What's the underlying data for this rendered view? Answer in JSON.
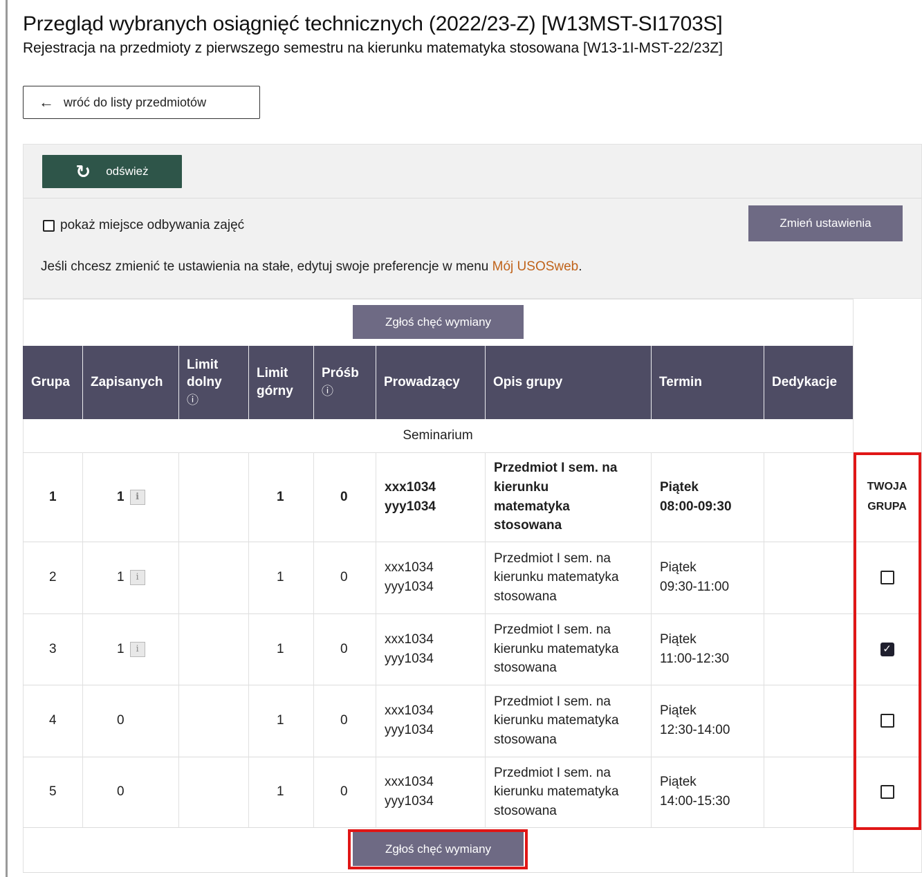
{
  "header": {
    "title": "Przegląd wybranych osiągnięć technicznych (2022/23-Z) [W13MST-SI1703S]",
    "subtitle": "Rejestracja na przedmioty z pierwszego semestru na kierunku matematyka stosowana [W13-1I-MST-22/23Z]"
  },
  "nav": {
    "back_label": "wróć do listy przedmiotów",
    "back_icon": "arrow-left-icon"
  },
  "settings": {
    "refresh_label": "odśwież",
    "show_location_label": "pokaż miejsce odbywania zajęć",
    "show_location_checked": false,
    "change_settings_label": "Zmień ustawienia",
    "pref_text": "Jeśli chcesz zmienić te ustawienia na stałe, edytuj swoje preferencje w menu ",
    "pref_link": "Mój USOSweb",
    "pref_end": ".",
    "link_color": "#c0631a"
  },
  "exchange_button_label": "Zgłoś chęć wymiany",
  "table": {
    "columns": {
      "grupa": "Grupa",
      "zapisanych": "Zapisanych",
      "limit_dolny_1": "Limit",
      "limit_dolny_2": "dolny",
      "limit_gorny_1": "Limit",
      "limit_gorny_2": "górny",
      "prosb": "Próśb",
      "prowadzacy": "Prowadzący",
      "opis": "Opis grupy",
      "termin": "Termin",
      "dedykacje": "Dedykacje",
      "info_icon": "ⓘ"
    },
    "section": "Seminarium",
    "your_group_line1": "TWOJA",
    "your_group_line2": "GRUPA",
    "rows": [
      {
        "grupa": "1",
        "zapisanych": "1",
        "limit_dolny": "",
        "limit_gorny": "1",
        "prosb": "0",
        "prowadzacy_1": "xxx1034",
        "prowadzacy_2": "yyy1034",
        "opis_1": "Przedmiot I sem. na",
        "opis_2": "kierunku",
        "opis_3": "matematyka",
        "opis_4": "stosowana",
        "dzien": "Piątek",
        "godziny": "08:00-09:30",
        "dedykacje": "",
        "selected": true
      },
      {
        "grupa": "2",
        "zapisanych": "1",
        "limit_dolny": "",
        "limit_gorny": "1",
        "prosb": "0",
        "prowadzacy_1": "xxx1034",
        "prowadzacy_2": "yyy1034",
        "opis_1": "Przedmiot I sem. na",
        "opis_2": "kierunku matematyka",
        "opis_3": "stosowana",
        "dzien": "Piątek",
        "godziny": "09:30-11:00",
        "dedykacje": "",
        "checked": false
      },
      {
        "grupa": "3",
        "zapisanych": "1",
        "limit_dolny": "",
        "limit_gorny": "1",
        "prosb": "0",
        "prowadzacy_1": "xxx1034",
        "prowadzacy_2": "yyy1034",
        "opis_1": "Przedmiot I sem. na",
        "opis_2": "kierunku matematyka",
        "opis_3": "stosowana",
        "dzien": "Piątek",
        "godziny": "11:00-12:30",
        "dedykacje": "",
        "checked": true
      },
      {
        "grupa": "4",
        "zapisanych": "0",
        "limit_dolny": "",
        "limit_gorny": "1",
        "prosb": "0",
        "prowadzacy_1": "xxx1034",
        "prowadzacy_2": "yyy1034",
        "opis_1": "Przedmiot I sem. na",
        "opis_2": "kierunku matematyka",
        "opis_3": "stosowana",
        "dzien": "Piątek",
        "godziny": "12:30-14:00",
        "dedykacje": "",
        "checked": false
      },
      {
        "grupa": "5",
        "zapisanych": "0",
        "limit_dolny": "",
        "limit_gorny": "1",
        "prosb": "0",
        "prowadzacy_1": "xxx1034",
        "prowadzacy_2": "yyy1034",
        "opis_1": "Przedmiot I sem. na",
        "opis_2": "kierunku matematyka",
        "opis_3": "stosowana",
        "dzien": "Piątek",
        "godziny": "14:00-15:30",
        "dedykacje": "",
        "checked": false
      }
    ]
  },
  "colors": {
    "header_bg": "#4e4c64",
    "refresh_bg": "#2e5549",
    "button_bg": "#6e6a84",
    "highlight": "#e01616"
  }
}
